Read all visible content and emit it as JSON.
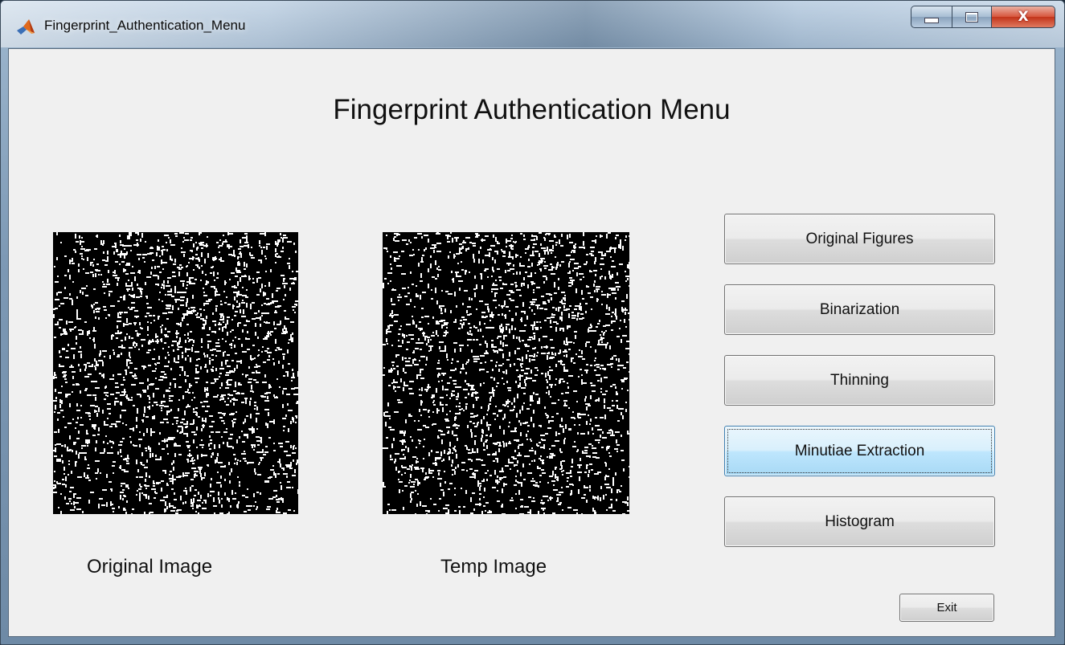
{
  "window": {
    "title": "Fingerprint_Authentication_Menu",
    "app_icon": "matlab-icon",
    "controls": {
      "minimize_icon": "minimize-icon",
      "maximize_icon": "maximize-icon",
      "close_icon": "close-icon",
      "close_glyph": "X"
    }
  },
  "main": {
    "heading": "Fingerprint Authentication Menu",
    "images": [
      {
        "caption": "Original Image"
      },
      {
        "caption": "Temp Image"
      }
    ],
    "buttons": [
      {
        "label": "Original Figures"
      },
      {
        "label": "Binarization"
      },
      {
        "label": "Thinning"
      },
      {
        "label": "Minutiae Extraction",
        "focused": true
      },
      {
        "label": "Histogram"
      }
    ],
    "exit_label": "Exit"
  },
  "colors": {
    "client_bg": "#f0f0f0",
    "focused_button": "#bee6fd",
    "image_bg": "#000000",
    "image_fg": "#ffffff"
  }
}
